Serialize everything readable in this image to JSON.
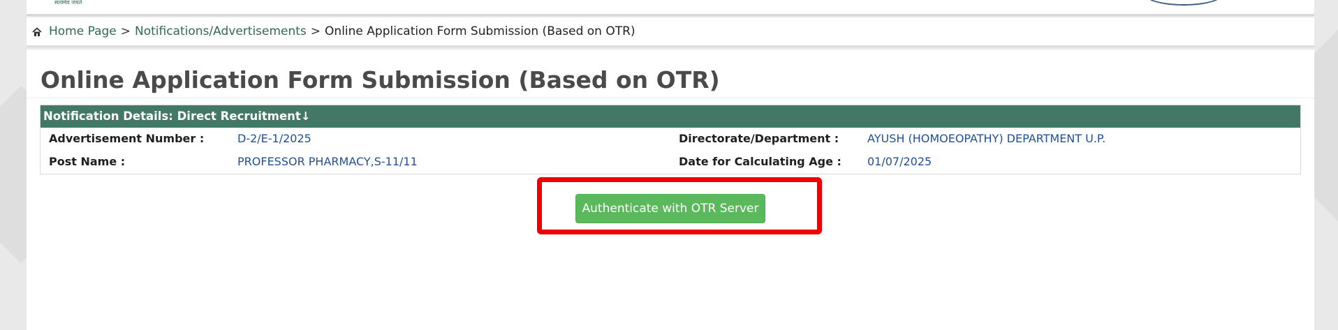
{
  "header": {
    "logo_caption": "सत्यमेव जयते"
  },
  "breadcrumb": {
    "home": "Home Page",
    "separator": ">",
    "notifications": "Notifications/Advertisements",
    "current": "Online Application Form Submission (Based on OTR)"
  },
  "page": {
    "title": "Online Application Form Submission (Based on OTR)"
  },
  "notification": {
    "header": "Notification Details: Direct Recruitment↓",
    "advertisement_number_label": "Advertisement Number :",
    "advertisement_number": "D-2/E-1/2025",
    "directorate_label": "Directorate/Department :",
    "directorate": "AYUSH (HOMOEOPATHY) DEPARTMENT U.P.",
    "post_name_label": "Post Name :",
    "post_name": "PROFESSOR PHARMACY,S-11/11",
    "date_age_label": "Date for Calculating Age :",
    "date_age": "01/07/2025"
  },
  "actions": {
    "authenticate_label": "Authenticate with OTR Server"
  },
  "colors": {
    "accent_green": "#447866",
    "button_green": "#5cb85c",
    "link_blue": "#1f4e9a",
    "highlight_red": "#ee0000"
  }
}
